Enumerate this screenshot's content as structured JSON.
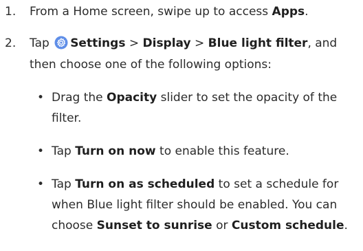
{
  "steps": [
    {
      "number": "1.",
      "pre": "From a Home screen, swipe up to access ",
      "bold1": "Apps",
      "post": "."
    },
    {
      "number": "2.",
      "pre": "Tap ",
      "icon": "settings-gear-icon",
      "settings": "Settings",
      "sep1": " > ",
      "display": "Display",
      "sep2": " > ",
      "blf": "Blue light filter",
      "post": ", and then choose one of the following options:"
    }
  ],
  "bullets": [
    {
      "dot": "•",
      "pre": "Drag the ",
      "bold": "Opacity",
      "post": " slider to set the opacity of the filter."
    },
    {
      "dot": "•",
      "pre": "Tap ",
      "bold": "Turn on now",
      "post": " to enable this feature."
    },
    {
      "dot": "•",
      "pre": "Tap ",
      "bold": "Turn on as scheduled",
      "mid": " to set a schedule for when Blue light filter should be enabled. You can choose ",
      "bold2": "Sunset to sunrise",
      "mid2": " or ",
      "bold3": "Custom schedule",
      "post": "."
    }
  ],
  "colors": {
    "icon_bg": "#5f8ee8",
    "text": "#2b2b2b"
  }
}
